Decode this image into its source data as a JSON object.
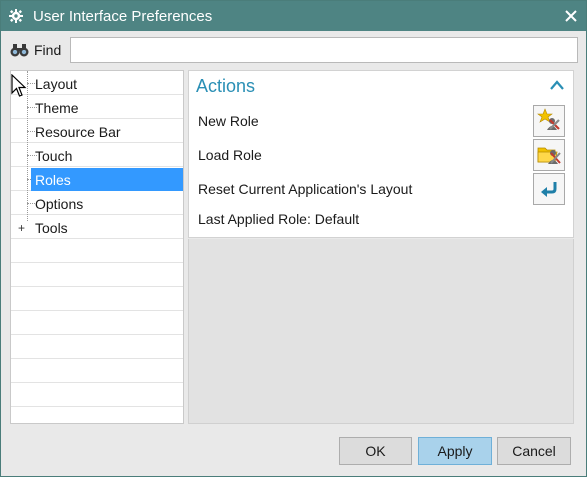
{
  "window": {
    "title": "User Interface Preferences",
    "accent_color": "#4e8483",
    "app_icon": "gear-icon",
    "close_icon": "close-icon"
  },
  "find": {
    "label": "Find",
    "value": "",
    "placeholder": "",
    "icon": "binoculars-icon"
  },
  "tree": {
    "items": [
      {
        "label": "Layout",
        "selected": false,
        "expandable": false
      },
      {
        "label": "Theme",
        "selected": false,
        "expandable": false
      },
      {
        "label": "Resource Bar",
        "selected": false,
        "expandable": false
      },
      {
        "label": "Touch",
        "selected": false,
        "expandable": false
      },
      {
        "label": "Roles",
        "selected": true,
        "expandable": false
      },
      {
        "label": "Options",
        "selected": false,
        "expandable": false
      },
      {
        "label": "Tools",
        "selected": false,
        "expandable": true,
        "expander_symbol": "+"
      }
    ],
    "selection_color": "#3399ff"
  },
  "actions_panel": {
    "title": "Actions",
    "title_color": "#2a8fb5",
    "collapse_icon": "chevron-up-icon",
    "rows": [
      {
        "label": "New Role",
        "icon": "new-role-icon"
      },
      {
        "label": "Load Role",
        "icon": "load-role-icon"
      },
      {
        "label": "Reset Current Application's Layout",
        "icon": "reset-layout-icon"
      }
    ],
    "status": "Last Applied Role: Default"
  },
  "buttons": {
    "ok": "OK",
    "apply": "Apply",
    "cancel": "Cancel"
  }
}
